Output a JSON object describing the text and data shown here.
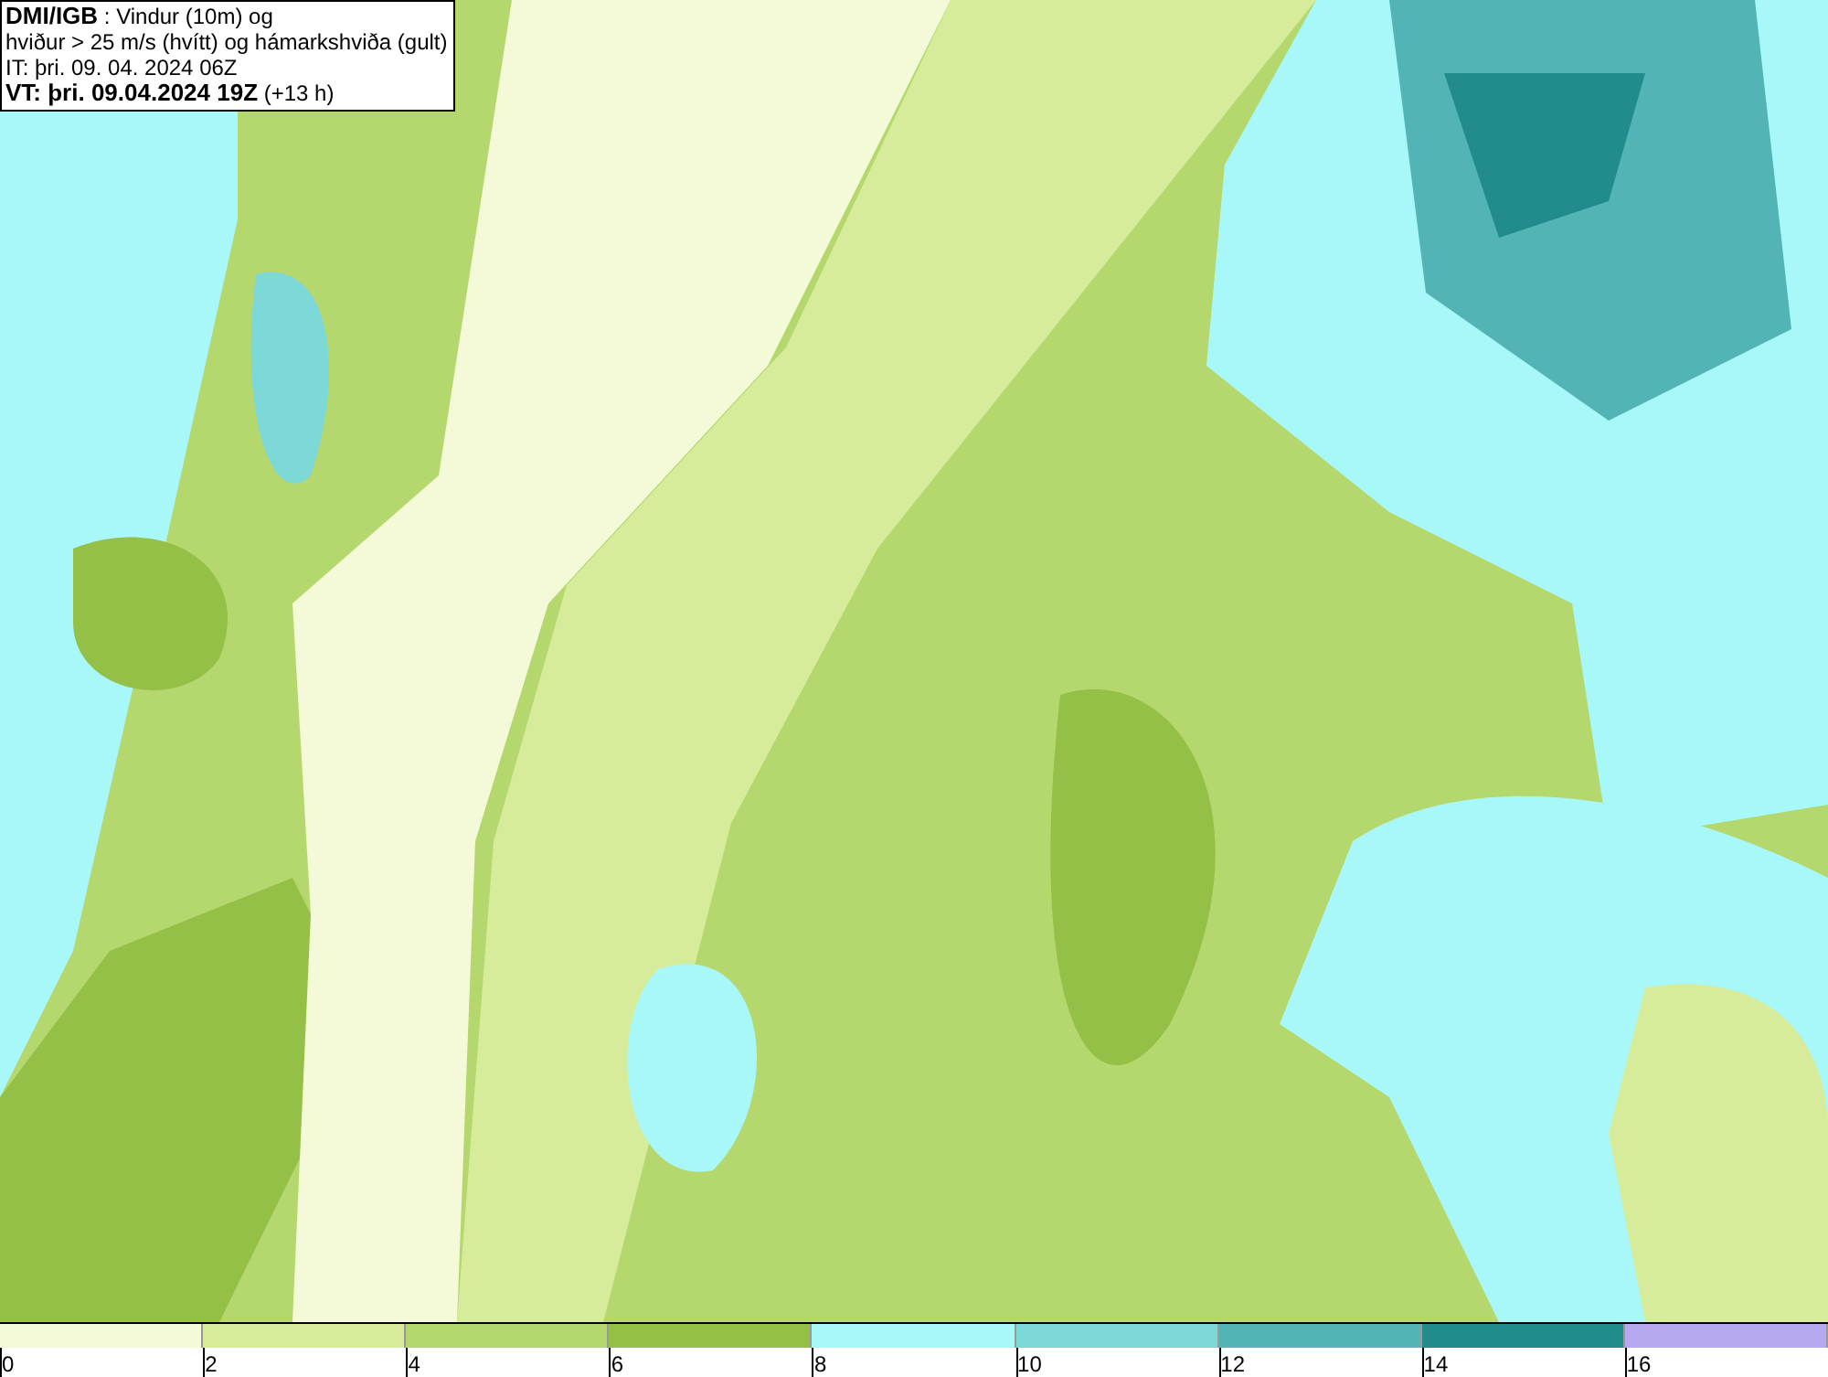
{
  "info_box": {
    "lines": [
      "**DMI/IGB** : Vindur (10m) og",
      "hviður > 25 m/s (hvítt) og hámarkshviða (gult)",
      "IT: þri. 09. 04. 2024 06Z",
      "**VT: þri. 09.04.2024 19Z** (+13 h)"
    ]
  },
  "legend": [
    {
      "color": "#f4fad8",
      "label": "0"
    },
    {
      "color": "#d6ec9a",
      "label": "2"
    },
    {
      "color": "#b5d86e",
      "label": "4"
    },
    {
      "color": "#95c047",
      "label": "6"
    },
    {
      "color": "#a8f8fa",
      "label": "8"
    },
    {
      "color": "#7dd8d8",
      "label": "10"
    },
    {
      "color": "#52b4b4",
      "label": "12"
    },
    {
      "color": "#228c8c",
      "label": "14"
    },
    {
      "color": "#b8a8f0",
      "label": "16"
    }
  ]
}
